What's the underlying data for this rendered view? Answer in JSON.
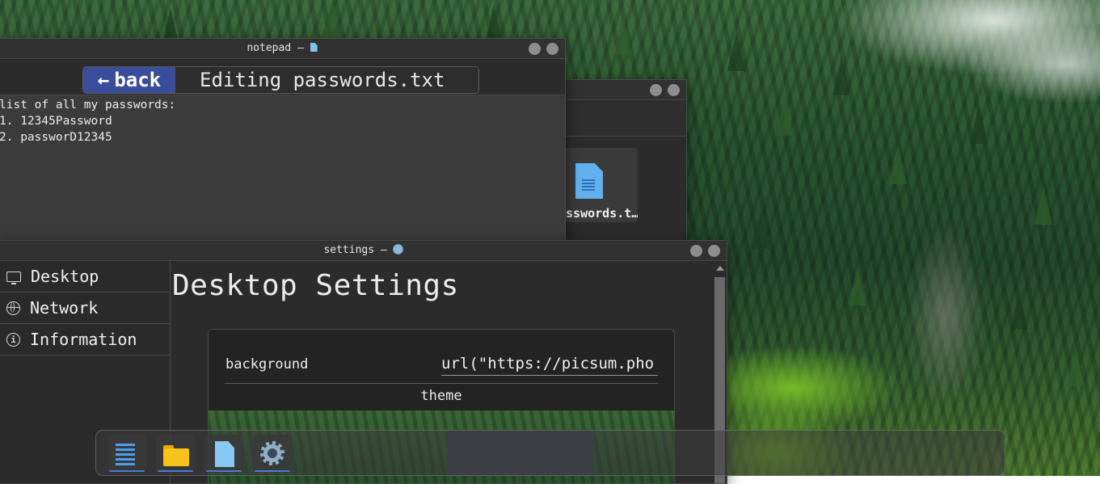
{
  "notepad": {
    "title": "notepad –",
    "back_label": "back",
    "back_arrow": "←",
    "editing_title": "Editing passwords.txt",
    "content": "list of all my passwords:\n1. 12345Password\n2. passworD12345"
  },
  "file_manager": {
    "file_name": "asswords.t…"
  },
  "settings": {
    "title": "settings –",
    "sidebar": [
      {
        "label": "Desktop",
        "icon": "monitor-icon"
      },
      {
        "label": "Network",
        "icon": "globe-icon"
      },
      {
        "label": "Information",
        "icon": "info-icon"
      }
    ],
    "heading": "Desktop Settings",
    "background_label": "background",
    "background_value": "url(\"https://picsum.pho",
    "theme_label": "theme"
  },
  "dock": {
    "items": [
      "list-icon",
      "folder-icon",
      "document-icon",
      "gear-icon"
    ]
  },
  "colors": {
    "accent": "#3a4d9a",
    "dock_indicator": "#4a7bd6",
    "window_bg": "#2b2b2b"
  }
}
